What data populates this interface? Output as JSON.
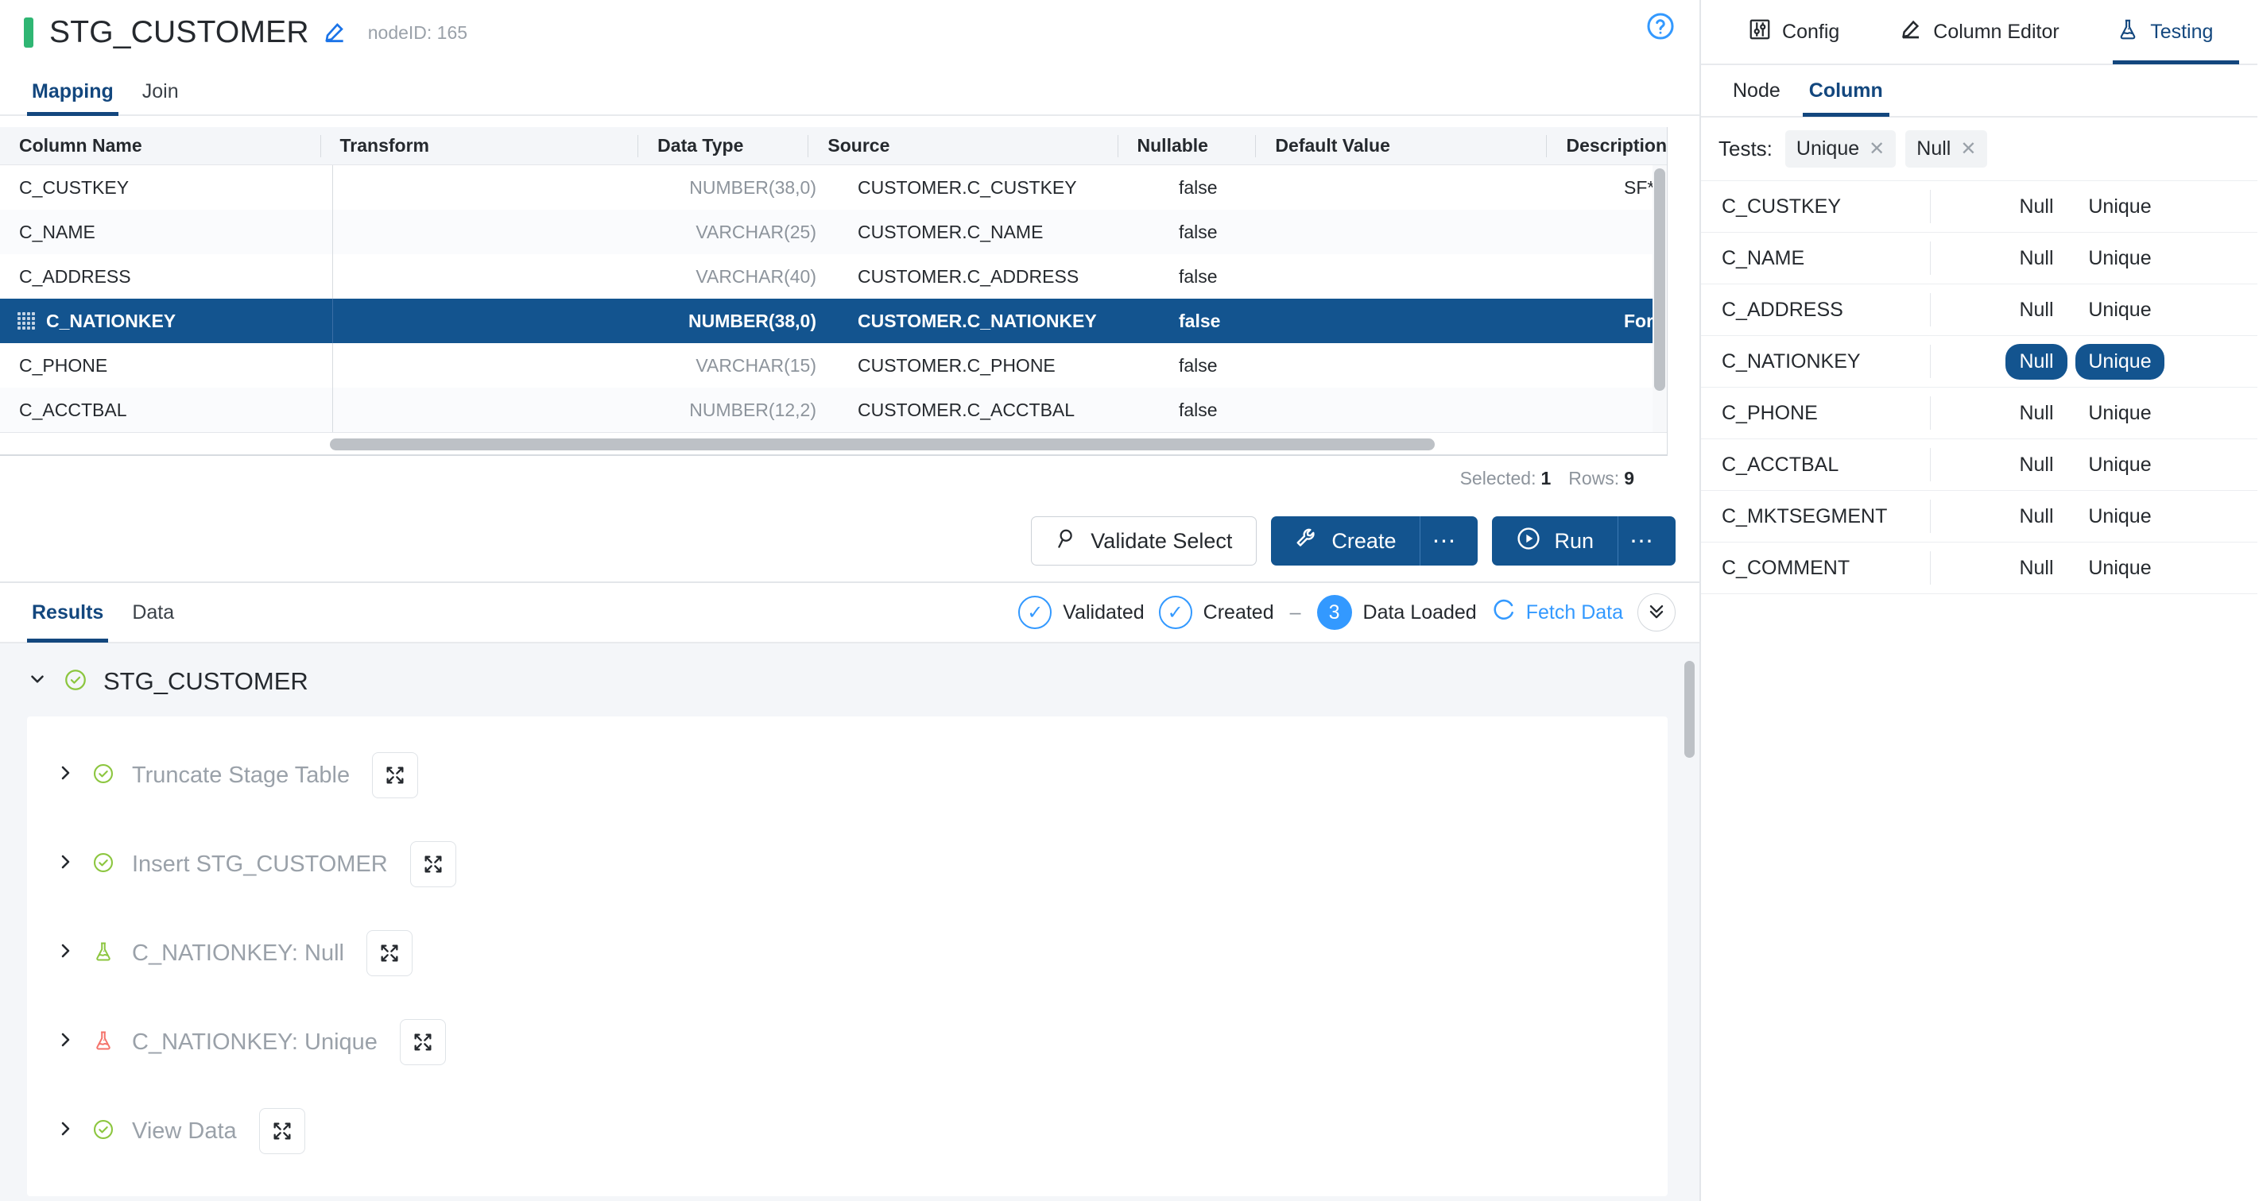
{
  "header": {
    "title": "STG_CUSTOMER",
    "node_id": "nodeID: 165",
    "edit_icon": "pencil-icon",
    "help_icon": "help-circle-icon",
    "accent_color": "#2fb673"
  },
  "main_tabs": [
    {
      "label": "Mapping",
      "active": true
    },
    {
      "label": "Join",
      "active": false
    }
  ],
  "grid": {
    "columns": [
      "Column Name",
      "Transform",
      "Data Type",
      "Source",
      "Nullable",
      "Default Value",
      "Description"
    ],
    "rows": [
      {
        "name": "C_CUSTKEY",
        "transform": "",
        "type": "NUMBER(38,0)",
        "source": "CUSTOMER.C_CUSTKEY",
        "nullable": "false",
        "default": "",
        "description": "SF*",
        "selected": false
      },
      {
        "name": "C_NAME",
        "transform": "",
        "type": "VARCHAR(25)",
        "source": "CUSTOMER.C_NAME",
        "nullable": "false",
        "default": "",
        "description": "",
        "selected": false
      },
      {
        "name": "C_ADDRESS",
        "transform": "",
        "type": "VARCHAR(40)",
        "source": "CUSTOMER.C_ADDRESS",
        "nullable": "false",
        "default": "",
        "description": "",
        "selected": false
      },
      {
        "name": "C_NATIONKEY",
        "transform": "",
        "type": "NUMBER(38,0)",
        "source": "CUSTOMER.C_NATIONKEY",
        "nullable": "false",
        "default": "",
        "description": "For",
        "selected": true
      },
      {
        "name": "C_PHONE",
        "transform": "",
        "type": "VARCHAR(15)",
        "source": "CUSTOMER.C_PHONE",
        "nullable": "false",
        "default": "",
        "description": "",
        "selected": false
      },
      {
        "name": "C_ACCTBAL",
        "transform": "",
        "type": "NUMBER(12,2)",
        "source": "CUSTOMER.C_ACCTBAL",
        "nullable": "false",
        "default": "",
        "description": "",
        "selected": false
      }
    ],
    "selected_label": "Selected:",
    "selected_count": "1",
    "rows_label": "Rows:",
    "rows_count": "9"
  },
  "actions": {
    "validate_label": "Validate Select",
    "validate_icon": "magnifier-icon",
    "create_label": "Create",
    "create_icon": "wrench-icon",
    "run_label": "Run",
    "run_icon": "play-circle-icon",
    "overflow_glyph": "⋯",
    "primary_color": "#13548f"
  },
  "results": {
    "tabs": [
      {
        "label": "Results",
        "active": true
      },
      {
        "label": "Data",
        "active": false
      }
    ],
    "status": {
      "validated": "Validated",
      "created": "Created",
      "separator": "–",
      "data_loaded_count": "3",
      "data_loaded": "Data Loaded",
      "fetch_data": "Fetch Data",
      "fetch_icon": "refresh-icon",
      "collapse_icon": "chevron-double-down-icon",
      "accent_color": "#3399ff"
    },
    "root": {
      "label": "STG_CUSTOMER",
      "icon": "check-circle-icon",
      "chevron": "chevron-down-icon"
    },
    "items": [
      {
        "label": "Truncate Stage Table",
        "icon": "check-circle-icon",
        "icon_color": "#8cc63f",
        "chevron": "chevron-right-icon",
        "expand_icon": "expand-arrows-icon"
      },
      {
        "label": "Insert STG_CUSTOMER",
        "icon": "check-circle-icon",
        "icon_color": "#8cc63f",
        "chevron": "chevron-right-icon",
        "expand_icon": "expand-arrows-icon"
      },
      {
        "label": "C_NATIONKEY: Null",
        "icon": "flask-icon",
        "icon_color": "#8cc63f",
        "chevron": "chevron-right-icon",
        "expand_icon": "expand-arrows-icon"
      },
      {
        "label": "C_NATIONKEY: Unique",
        "icon": "flask-icon",
        "icon_color": "#f4726a",
        "chevron": "chevron-right-icon",
        "expand_icon": "expand-arrows-icon"
      },
      {
        "label": "View Data",
        "icon": "check-circle-icon",
        "icon_color": "#8cc63f",
        "chevron": "chevron-right-icon",
        "expand_icon": "expand-arrows-icon"
      }
    ]
  },
  "right_panel": {
    "tabs": [
      {
        "label": "Config",
        "icon": "sliders-icon",
        "active": false
      },
      {
        "label": "Column Editor",
        "icon": "pencil-icon",
        "active": false
      },
      {
        "label": "Testing",
        "icon": "flask-icon",
        "active": true
      }
    ],
    "subtabs": [
      {
        "label": "Node",
        "active": false
      },
      {
        "label": "Column",
        "active": true
      }
    ],
    "tests_label": "Tests:",
    "test_chips": [
      {
        "label": "Unique",
        "remove_icon": "close-icon"
      },
      {
        "label": "Null",
        "remove_icon": "close-icon"
      }
    ],
    "test_columns": [
      "Null",
      "Unique"
    ],
    "test_rows": [
      {
        "column": "C_CUSTKEY",
        "null_active": false,
        "unique_active": false
      },
      {
        "column": "C_NAME",
        "null_active": false,
        "unique_active": false
      },
      {
        "column": "C_ADDRESS",
        "null_active": false,
        "unique_active": false
      },
      {
        "column": "C_NATIONKEY",
        "null_active": true,
        "unique_active": true
      },
      {
        "column": "C_PHONE",
        "null_active": false,
        "unique_active": false
      },
      {
        "column": "C_ACCTBAL",
        "null_active": false,
        "unique_active": false
      },
      {
        "column": "C_MKTSEGMENT",
        "null_active": false,
        "unique_active": false
      },
      {
        "column": "C_COMMENT",
        "null_active": false,
        "unique_active": false
      }
    ]
  }
}
